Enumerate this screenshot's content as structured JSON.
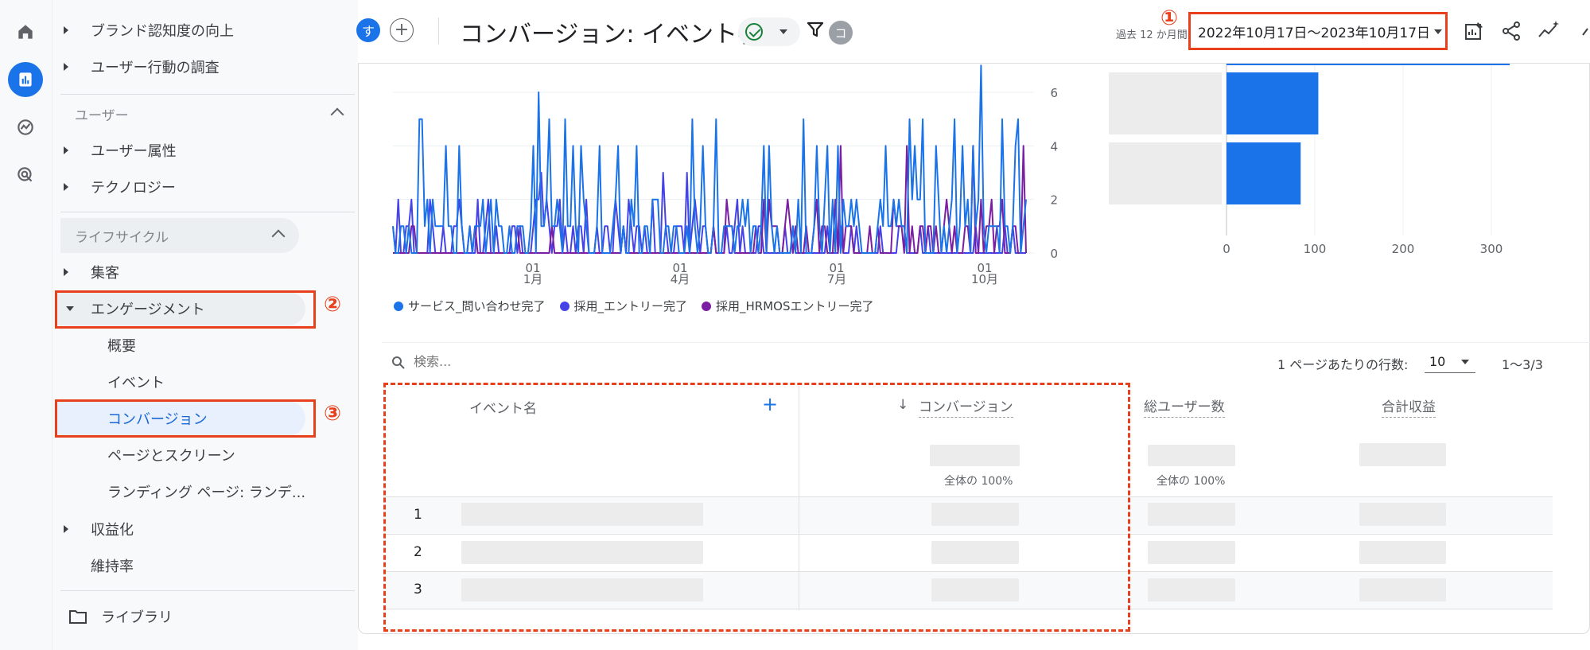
{
  "sidebar": {
    "items_top": [
      {
        "label": "ブランド認知度の向上"
      },
      {
        "label": "ユーザー行動の調査"
      }
    ],
    "user_section": {
      "title": "ユーザー",
      "items": [
        {
          "label": "ユーザー属性"
        },
        {
          "label": "テクノロジー"
        }
      ]
    },
    "lifecycle_section": {
      "title": "ライフサイクル",
      "items": [
        {
          "label": "集客"
        },
        {
          "label": "エンゲージメント"
        }
      ],
      "engagement_children": [
        {
          "label": "概要"
        },
        {
          "label": "イベント"
        },
        {
          "label": "コンバージョン"
        },
        {
          "label": "ページとスクリーン"
        },
        {
          "label": "ランディング ページ: ランデ..."
        }
      ],
      "after": [
        {
          "label": "収益化"
        },
        {
          "label": "維持率"
        }
      ]
    },
    "library_label": "ライブラリ"
  },
  "annotations": {
    "one": "①",
    "two": "②",
    "three": "③"
  },
  "header": {
    "avatar_letter": "す",
    "plus": "+",
    "title": "コンバージョン: イベント名",
    "comparison_letter": "コ",
    "period_label": "過去 12 か月間",
    "date_range": "2022年10月17日〜2023年10月17日"
  },
  "chart_data": [
    {
      "type": "line",
      "x_ticks": [
        {
          "top": "01",
          "bottom": "1月"
        },
        {
          "top": "01",
          "bottom": "4月"
        },
        {
          "top": "01",
          "bottom": "7月"
        },
        {
          "top": "01",
          "bottom": "10月"
        }
      ],
      "yticks": [
        0,
        2,
        4,
        6
      ],
      "ylim": [
        0,
        6
      ],
      "series": [
        {
          "name": "サービス_問い合わせ完了",
          "color": "#1a73e8"
        },
        {
          "name": "採用_エントリー完了",
          "color": "#4543e8"
        },
        {
          "name": "採用_HRMOSエントリー完了",
          "color": "#7b1fa2"
        }
      ]
    },
    {
      "type": "bar",
      "orientation": "horizontal",
      "values": [
        104,
        84
      ],
      "xticks": [
        0,
        100,
        200,
        300
      ],
      "xlim": [
        0,
        340
      ],
      "color": "#1a73e8"
    }
  ],
  "table": {
    "search_placeholder": "検索...",
    "rows_per_page_label": "1 ページあたりの行数:",
    "rows_per_page": "10",
    "pager": "1〜3/3",
    "columns": {
      "event_name": "イベント名",
      "conversions": "コンバージョン",
      "total_users": "総ユーザー数",
      "total_revenue": "合計収益"
    },
    "sort_arrow": "↓",
    "add": "+",
    "total_pct_conv": "全体の 100%",
    "total_pct_users": "全体の 100%",
    "rows": [
      {
        "num": "1"
      },
      {
        "num": "2"
      },
      {
        "num": "3"
      }
    ]
  }
}
